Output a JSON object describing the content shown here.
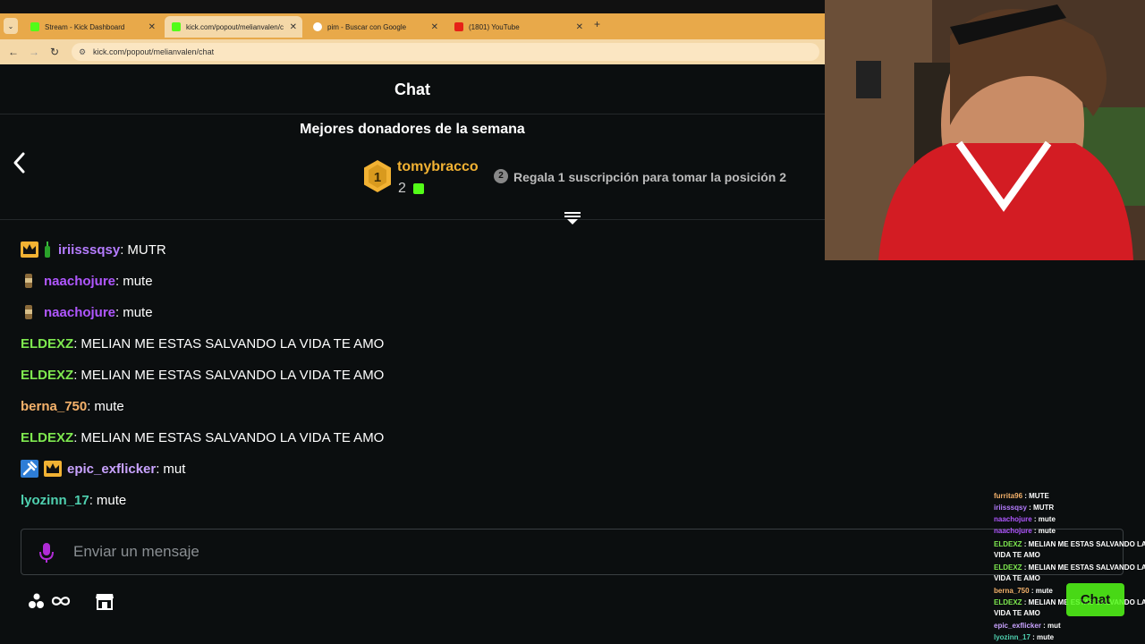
{
  "browser": {
    "tabs": [
      {
        "label": "Stream - Kick Dashboard"
      },
      {
        "label": "kick.com/popout/melianvalen/c"
      },
      {
        "label": "pim - Buscar con Google"
      },
      {
        "label": "(1801) YouTube"
      }
    ],
    "url": "kick.com/popout/melianvalen/chat"
  },
  "chat": {
    "title": "Chat",
    "donors_title": "Mejores donadores de la semana",
    "top_donor": {
      "rank": "1",
      "name": "tomybracco",
      "count": "2"
    },
    "position2": {
      "rank": "2",
      "text": "Regala 1 suscripción para tomar la posición 2"
    },
    "messages": [
      {
        "user": "iriisssqsy",
        "text": "MUTR",
        "color": "#b57cff"
      },
      {
        "user": "naachojure",
        "text": "mute",
        "color": "#b057ff"
      },
      {
        "user": "naachojure",
        "text": "mute",
        "color": "#b057ff"
      },
      {
        "user": "ELDEXZ",
        "text": "MELIAN ME ESTAS SALVANDO LA VIDA TE AMO",
        "color": "#7ee84f"
      },
      {
        "user": "ELDEXZ",
        "text": "MELIAN ME ESTAS SALVANDO LA VIDA TE AMO",
        "color": "#7ee84f"
      },
      {
        "user": "berna_750",
        "text": "mute",
        "color": "#f5b26b"
      },
      {
        "user": "ELDEXZ",
        "text": "MELIAN ME ESTAS SALVANDO LA VIDA TE AMO",
        "color": "#7ee84f"
      },
      {
        "user": "epic_exflicker",
        "text": "mut",
        "color": "#c9a3ff"
      },
      {
        "user": "lyozinn_17",
        "text": "mute",
        "color": "#4fd1b0"
      }
    ],
    "input_placeholder": "Enviar un mensaje",
    "chat_button": "Chat"
  },
  "overlay": {
    "lines": [
      {
        "user": "furrita96",
        "text": "MUTE",
        "color": "#f5b26b"
      },
      {
        "user": "iriisssqsy",
        "text": "MUTR",
        "color": "#b57cff"
      },
      {
        "user": "naachojure",
        "text": "mute",
        "color": "#b057ff"
      },
      {
        "user": "naachojure",
        "text": "mute",
        "color": "#b057ff"
      },
      {
        "user": "ELDEXZ",
        "text": "MELIAN ME ESTAS SALVANDO LA",
        "color": "#7ee84f"
      },
      {
        "user": "",
        "text": "VIDA TE AMO",
        "color": "#7ee84f"
      },
      {
        "user": "ELDEXZ",
        "text": "MELIAN ME ESTAS SALVANDO LA",
        "color": "#7ee84f"
      },
      {
        "user": "",
        "text": "VIDA TE AMO",
        "color": "#7ee84f"
      },
      {
        "user": "berna_750",
        "text": "mute",
        "color": "#f5b26b"
      },
      {
        "user": "ELDEXZ",
        "text": "MELIAN ME ESTAS SALVANDO LA",
        "color": "#7ee84f"
      },
      {
        "user": "",
        "text": "VIDA TE AMO",
        "color": "#7ee84f"
      },
      {
        "user": "epic_exflicker",
        "text": "mut",
        "color": "#c9a3ff"
      },
      {
        "user": "lyozinn_17",
        "text": "mute",
        "color": "#4fd1b0"
      }
    ]
  }
}
